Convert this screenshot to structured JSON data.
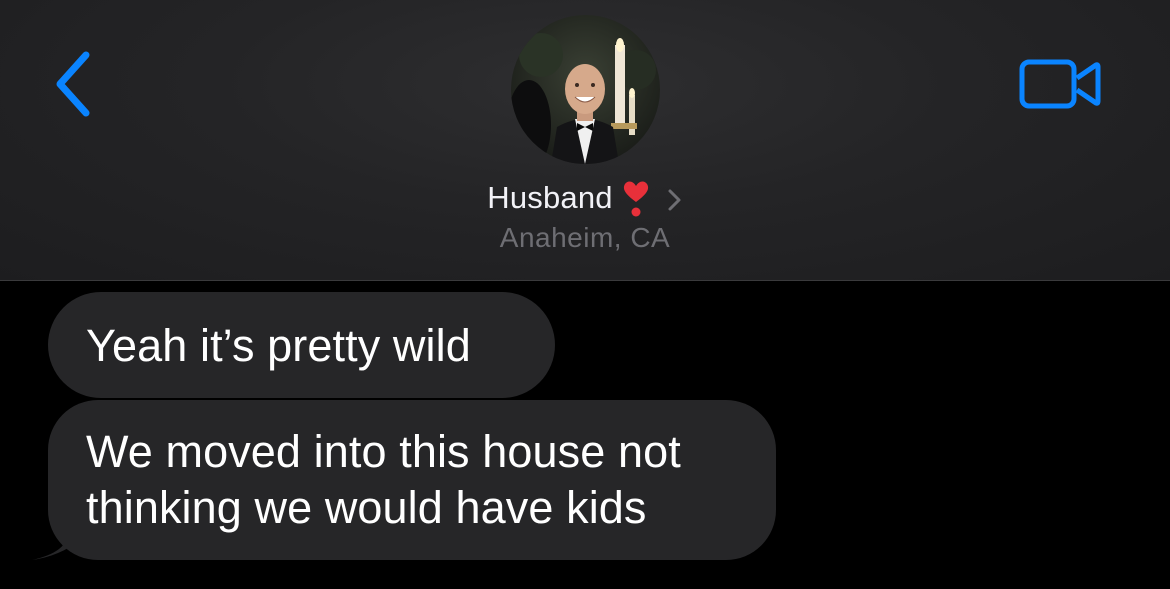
{
  "header": {
    "back_icon": "chevron-left-icon",
    "video_icon": "video-camera-icon",
    "contact_name": "Husband",
    "contact_emoji": "heart-exclamation-icon",
    "contact_subtitle": "Anaheim, CA",
    "accent_color": "#0a84ff"
  },
  "messages": [
    {
      "direction": "incoming",
      "text": "Yeah it’s pretty wild"
    },
    {
      "direction": "incoming",
      "lines": [
        "We moved into this house not",
        "thinking we would have kids"
      ]
    }
  ],
  "colors": {
    "background": "#000000",
    "header_background": "#242426",
    "incoming_bubble": "#262628",
    "subtitle": "#6e6e73"
  }
}
